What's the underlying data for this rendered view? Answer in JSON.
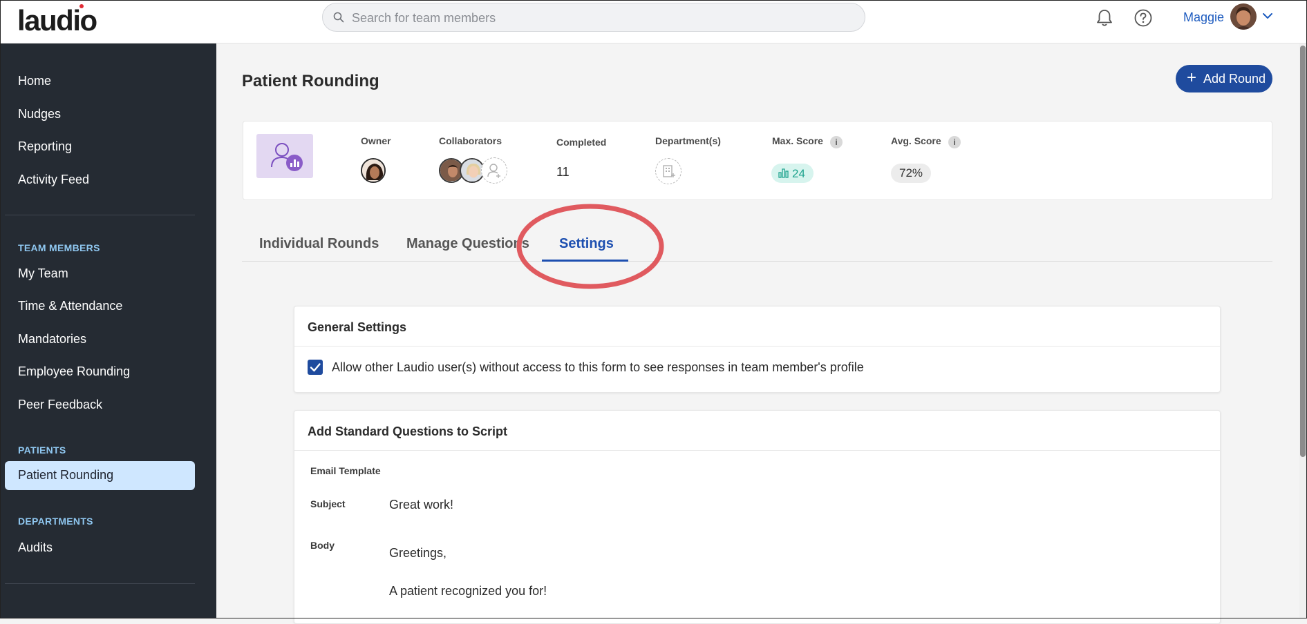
{
  "app": {
    "logo": "laudio"
  },
  "search": {
    "placeholder": "Search for team members"
  },
  "header": {
    "user_name": "Maggie",
    "icons": [
      "bell-icon",
      "help-circle-icon",
      "chevron-down-icon"
    ]
  },
  "sidebar": {
    "items_top": [
      "Home",
      "Nudges",
      "Reporting",
      "Activity Feed"
    ],
    "section_team": "TEAM MEMBERS",
    "items_team": [
      "My Team",
      "Time & Attendance",
      "Mandatories",
      "Employee Rounding",
      "Peer Feedback"
    ],
    "section_patients": "PATIENTS",
    "active_item": "Patient Rounding",
    "section_departments": "DEPARTMENTS",
    "items_departments": [
      "Audits"
    ]
  },
  "page": {
    "title": "Patient Rounding",
    "add_button": "Add Round"
  },
  "summary": {
    "owner_label": "Owner",
    "collaborators_label": "Collaborators",
    "completed_label": "Completed",
    "completed_value": "11",
    "departments_label": "Department(s)",
    "max_score_label": "Max. Score",
    "max_score_value": "24",
    "avg_score_label": "Avg. Score",
    "avg_score_value": "72%",
    "info_glyph": "i"
  },
  "tabs": [
    {
      "label": "Individual Rounds",
      "active": false
    },
    {
      "label": "Manage Questions",
      "active": false
    },
    {
      "label": "Settings",
      "active": true
    }
  ],
  "general_settings": {
    "title": "General Settings",
    "checkbox_checked": true,
    "checkbox_label": "Allow other Laudio user(s) without access to this form to see responses in team member's profile"
  },
  "standard_questions": {
    "title": "Add Standard Questions to Script",
    "email_template_label": "Email Template",
    "subject_label": "Subject",
    "subject_value": "Great work!",
    "body_label": "Body",
    "body_line1": "Greetings,",
    "body_line2": "A patient recognized you for!"
  },
  "colors": {
    "sidebar_bg": "#252b33",
    "accent": "#1d4fb0",
    "active_nav_bg": "#cfe7ff",
    "highlight": "#e05a5f"
  }
}
